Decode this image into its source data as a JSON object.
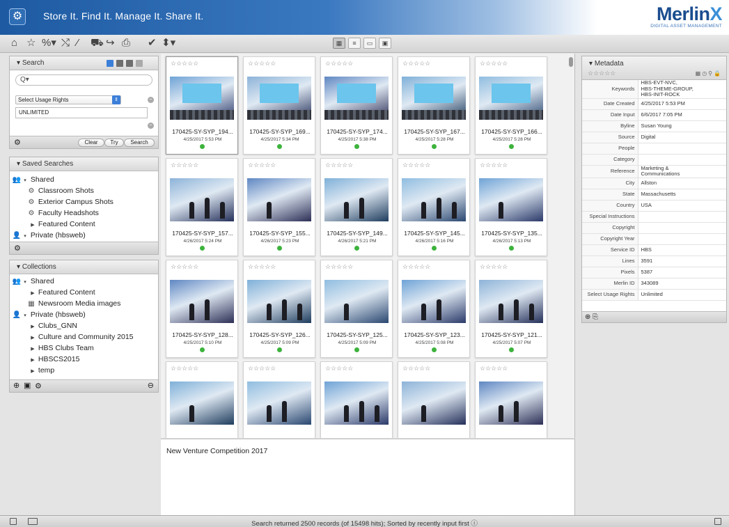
{
  "header": {
    "tagline": "Store It. Find It. Manage It. Share It.",
    "brand_name": "Merlin",
    "brand_x": "X",
    "brand_sub": "DIGITAL ASSET MANAGEMENT"
  },
  "toolbar": {
    "icons": [
      "home-icon",
      "star-icon",
      "tag-icon",
      "shuffle-icon",
      "wand-icon",
      "cart-icon",
      "share-icon",
      "print-icon",
      "checkmark-icon",
      "sort-icon"
    ],
    "views": [
      "grid-view-icon",
      "list-view-icon",
      "image-view-icon",
      "detail-view-icon"
    ]
  },
  "search": {
    "header": "Search",
    "placeholder": "Q",
    "usage_select": "Select Usage Rights",
    "usage_value": "UNLIMITED",
    "clear": "Clear",
    "try": "Try",
    "search": "Search"
  },
  "saved_searches": {
    "header": "Saved Searches",
    "items": [
      {
        "label": "Shared",
        "level": 0
      },
      {
        "label": "Classroom Shots",
        "level": 1
      },
      {
        "label": "Exterior Campus Shots",
        "level": 1
      },
      {
        "label": "Faculty Headshots",
        "level": 1
      },
      {
        "label": "Featured Content",
        "level": 1
      },
      {
        "label": "Private (hbsweb)",
        "level": 0
      }
    ]
  },
  "collections": {
    "header": "Collections",
    "items": [
      {
        "label": "Shared"
      },
      {
        "label": "Featured Content"
      },
      {
        "label": "Newsroom Media images"
      },
      {
        "label": "Private (hbsweb)"
      },
      {
        "label": "Clubs_GNN"
      },
      {
        "label": "Culture and Community 2015"
      },
      {
        "label": "HBS Clubs Team"
      },
      {
        "label": "HBSCS2015"
      },
      {
        "label": "temp"
      }
    ]
  },
  "grid": {
    "stars": "☆☆☆☆☆",
    "cards": [
      {
        "name": "170425-SY-SYP_194...",
        "date": "4/25/2017 5:53 PM"
      },
      {
        "name": "170425-SY-SYP_169...",
        "date": "4/25/2017 5:34 PM"
      },
      {
        "name": "170425-SY-SYP_174...",
        "date": "4/25/2017 5:38 PM"
      },
      {
        "name": "170425-SY-SYP_167...",
        "date": "4/25/2017 5:28 PM"
      },
      {
        "name": "170425-SY-SYP_166...",
        "date": "4/25/2017 5:28 PM"
      },
      {
        "name": "170425-SY-SYP_157...",
        "date": "4/26/2017 5:24 PM"
      },
      {
        "name": "170425-SY-SYP_155...",
        "date": "4/26/2017 5:23 PM"
      },
      {
        "name": "170425-SY-SYP_149...",
        "date": "4/26/2017 5:21 PM"
      },
      {
        "name": "170425-SY-SYP_145...",
        "date": "4/26/2017 5:16 PM"
      },
      {
        "name": "170425-SY-SYP_135...",
        "date": "4/26/2017 5:13 PM"
      },
      {
        "name": "170425-SY-SYP_128...",
        "date": "4/25/2017 5:10 PM"
      },
      {
        "name": "170425-SY-SYP_126...",
        "date": "4/25/2017 5:09 PM"
      },
      {
        "name": "170425-SY-SYP_125...",
        "date": "4/25/2017 5:09 PM"
      },
      {
        "name": "170425-SY-SYP_123...",
        "date": "4/25/2017 5:08 PM"
      },
      {
        "name": "170425-SY-SYP_121...",
        "date": "4/25/2017 5:07 PM"
      },
      {
        "name": "",
        "date": ""
      },
      {
        "name": "",
        "date": ""
      },
      {
        "name": "",
        "date": ""
      },
      {
        "name": "",
        "date": ""
      },
      {
        "name": "",
        "date": ""
      }
    ]
  },
  "description": "New Venture Competition 2017",
  "metadata": {
    "header": "Metadata",
    "stars": "☆☆☆☆☆",
    "rows": [
      {
        "k": "Keywords",
        "v": "HBS-EVT-NVC,\nHBS-THEME-GROUP,\nHBS-INIT-ROCK"
      },
      {
        "k": "Date Created",
        "v": "4/25/2017 5:53 PM"
      },
      {
        "k": "Date Input",
        "v": "6/6/2017 7:05 PM"
      },
      {
        "k": "Byline",
        "v": "Susan Young"
      },
      {
        "k": "Source",
        "v": "Digital"
      },
      {
        "k": "People",
        "v": ""
      },
      {
        "k": "Category",
        "v": ""
      },
      {
        "k": "Reference",
        "v": "Marketing &\nCommunications"
      },
      {
        "k": "City",
        "v": "Allston"
      },
      {
        "k": "State",
        "v": "Massachusetts"
      },
      {
        "k": "Country",
        "v": "USA"
      },
      {
        "k": "Special Instructions",
        "v": ""
      },
      {
        "k": "Copyright",
        "v": ""
      },
      {
        "k": "Copyright Year",
        "v": ""
      },
      {
        "k": "Service ID",
        "v": "HBS"
      },
      {
        "k": "Lines",
        "v": "3591"
      },
      {
        "k": "Pixels",
        "v": "5387"
      },
      {
        "k": "Merlin ID",
        "v": "343089"
      },
      {
        "k": "Select Usage Rights",
        "v": "Unlimited"
      }
    ]
  },
  "status": {
    "text": "Search returned 2500 records (of 15498 hits); Sorted by recently input first"
  }
}
